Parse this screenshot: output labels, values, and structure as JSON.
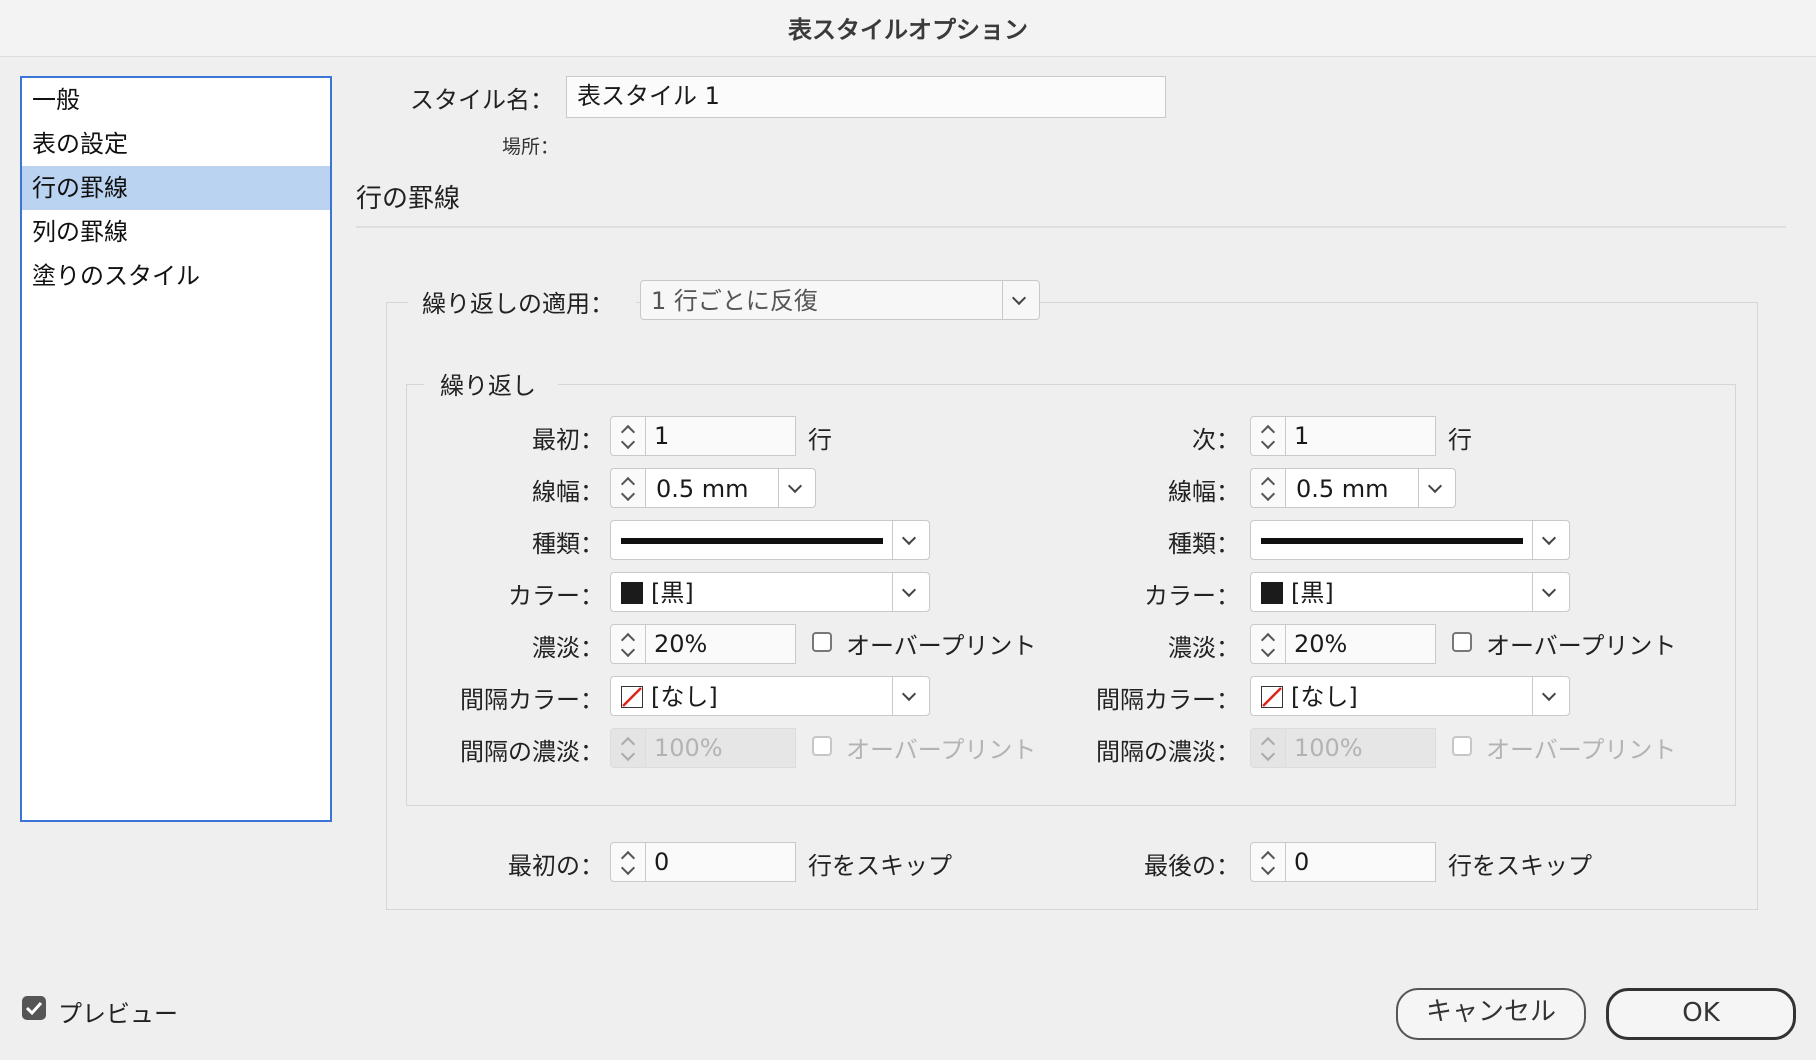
{
  "window": {
    "title": "表スタイルオプション"
  },
  "sidebar": {
    "items": [
      {
        "label": "一般"
      },
      {
        "label": "表の設定"
      },
      {
        "label": "行の罫線"
      },
      {
        "label": "列の罫線"
      },
      {
        "label": "塗りのスタイル"
      }
    ],
    "selected_index": 2
  },
  "style_name": {
    "label": "スタイル名：",
    "value": "表スタイル 1"
  },
  "location": {
    "label": "場所："
  },
  "section": {
    "title": "行の罫線"
  },
  "alternating": {
    "label": "繰り返しの適用：",
    "value": "1 行ごとに反復"
  },
  "repeat_group": {
    "title": "繰り返し"
  },
  "left": {
    "first_label": "最初：",
    "first_value": "1",
    "first_unit": "行",
    "weight_label": "線幅：",
    "weight_value": "0.5 mm",
    "type_label": "種類：",
    "color_label": "カラー：",
    "color_value": "[黒]",
    "tint_label": "濃淡：",
    "tint_value": "20%",
    "overprint_label": "オーバープリント",
    "gap_color_label": "間隔カラー：",
    "gap_color_value": "[なし]",
    "gap_tint_label": "間隔の濃淡：",
    "gap_tint_value": "100%",
    "gap_overprint_label": "オーバープリント"
  },
  "right": {
    "next_label": "次：",
    "next_value": "1",
    "next_unit": "行",
    "weight_label": "線幅：",
    "weight_value": "0.5 mm",
    "type_label": "種類：",
    "color_label": "カラー：",
    "color_value": "[黒]",
    "tint_label": "濃淡：",
    "tint_value": "20%",
    "overprint_label": "オーバープリント",
    "gap_color_label": "間隔カラー：",
    "gap_color_value": "[なし]",
    "gap_tint_label": "間隔の濃淡：",
    "gap_tint_value": "100%",
    "gap_overprint_label": "オーバープリント"
  },
  "skip": {
    "first_label": "最初の：",
    "first_value": "0",
    "first_unit": "行をスキップ",
    "last_label": "最後の：",
    "last_value": "0",
    "last_unit": "行をスキップ"
  },
  "footer": {
    "preview_label": "プレビュー",
    "preview_checked": true,
    "cancel_label": "キャンセル",
    "ok_label": "OK"
  },
  "colors": {
    "selection": "#b9d3f0",
    "list_focus": "#3a75d6",
    "swatch_black": "#1b1b1b",
    "none_slash": "#e0201b"
  }
}
